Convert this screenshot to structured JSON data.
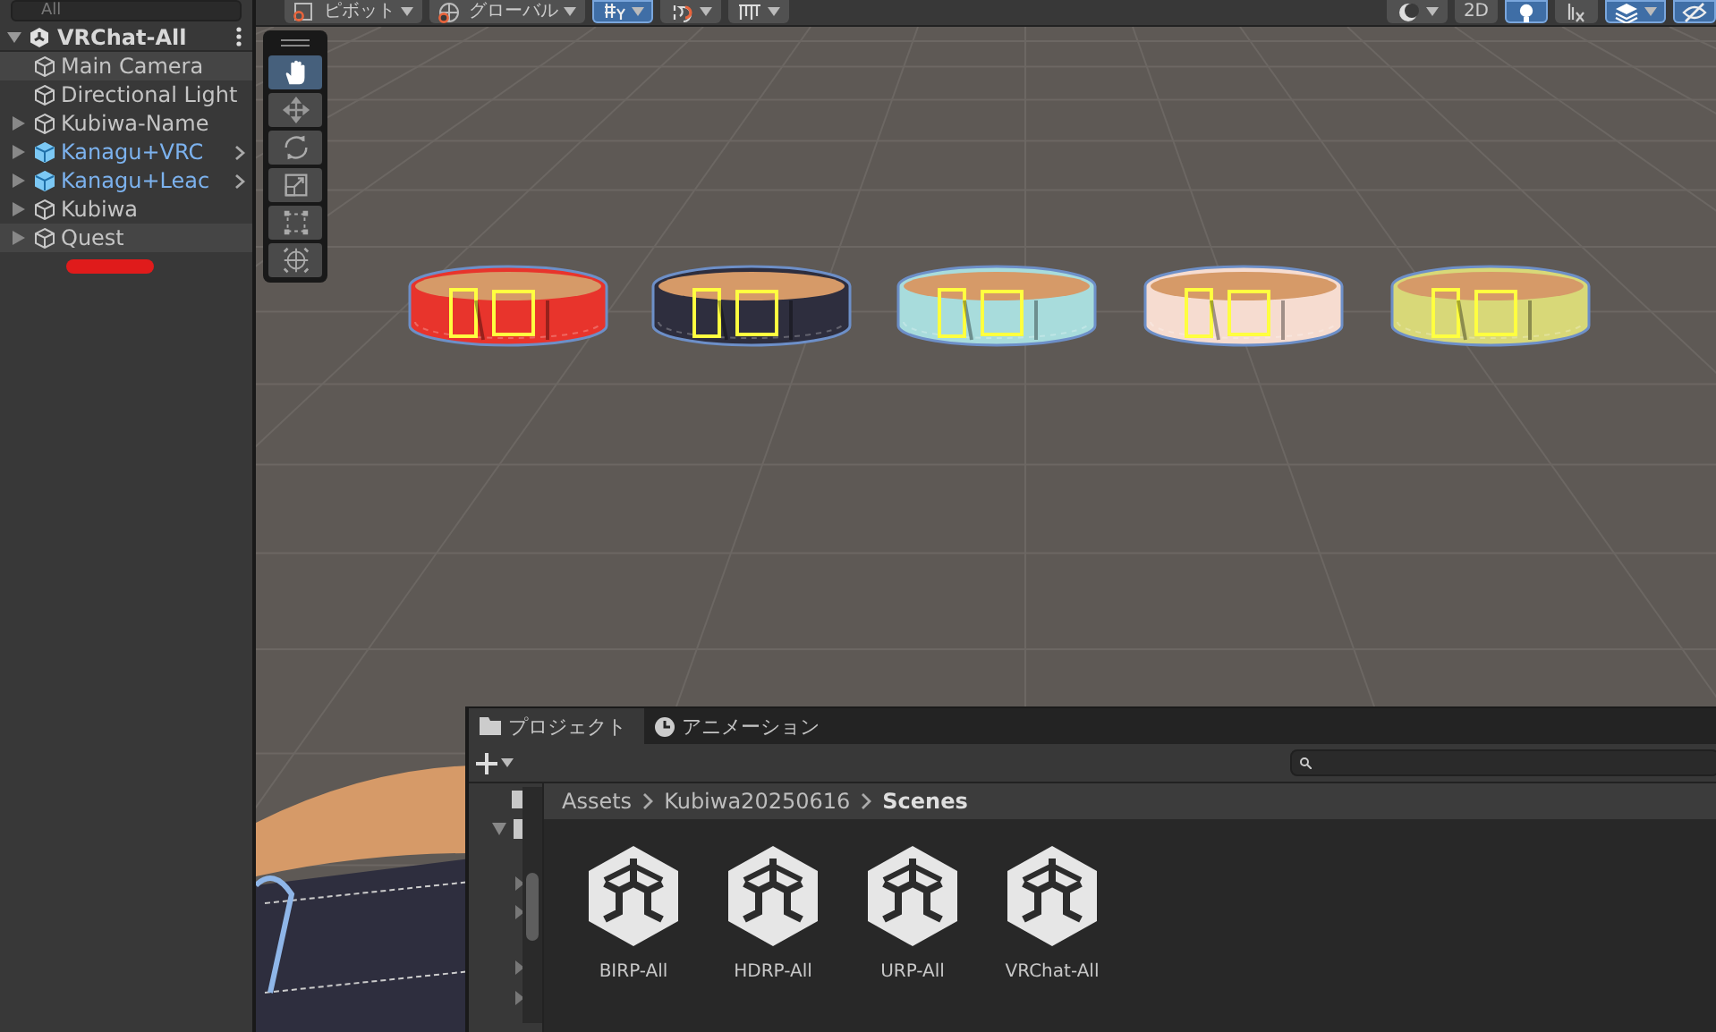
{
  "hierarchy": {
    "search": {
      "placeholder": "All"
    },
    "scene": {
      "name": "VRChat-All",
      "expanded": true
    },
    "items": [
      {
        "name": "Main Camera",
        "kind": "object",
        "expandable": false,
        "highlighted": true
      },
      {
        "name": "Directional Light",
        "kind": "object",
        "expandable": false,
        "highlighted": false
      },
      {
        "name": "Kubiwa-Name",
        "kind": "object",
        "expandable": true,
        "highlighted": false
      },
      {
        "name": "Kanagu+VRC",
        "kind": "prefab",
        "expandable": true,
        "highlighted": false
      },
      {
        "name": "Kanagu+Leac",
        "kind": "prefab",
        "expandable": true,
        "highlighted": false
      },
      {
        "name": "Kubiwa",
        "kind": "object",
        "expandable": true,
        "highlighted": false
      },
      {
        "name": "Quest",
        "kind": "object",
        "expandable": true,
        "highlighted": true
      }
    ]
  },
  "scene_toolbar": {
    "left": [
      {
        "kind": "pivot",
        "label": "ピボット"
      },
      {
        "kind": "global",
        "label": "グローバル"
      },
      {
        "kind": "grid",
        "active": true
      },
      {
        "kind": "snap",
        "active": false
      },
      {
        "kind": "ruler",
        "active": false
      }
    ],
    "right": [
      {
        "kind": "shading",
        "active": false
      },
      {
        "kind": "flat",
        "label": "2D",
        "active": false
      },
      {
        "kind": "light",
        "active": true
      },
      {
        "kind": "fx",
        "active": false
      },
      {
        "kind": "layers",
        "active": true
      },
      {
        "kind": "visibility",
        "active": true
      }
    ]
  },
  "tools": [
    {
      "kind": "hand",
      "selected": true
    },
    {
      "kind": "move",
      "selected": false
    },
    {
      "kind": "rotate",
      "selected": false
    },
    {
      "kind": "scale",
      "selected": false
    },
    {
      "kind": "rect",
      "selected": false
    },
    {
      "kind": "transform",
      "selected": false
    }
  ],
  "collars": [
    {
      "color": "#e8342c"
    },
    {
      "color": "#2e2e3e"
    },
    {
      "color": "#a8dcdc"
    },
    {
      "color": "#f6dcd0"
    },
    {
      "color": "#d8d878"
    }
  ],
  "project": {
    "tabs": [
      {
        "label": "プロジェクト",
        "kind": "folder",
        "selected": true
      },
      {
        "label": "アニメーション",
        "kind": "clock",
        "selected": false
      }
    ],
    "breadcrumb": [
      "Assets",
      "Kubiwa20250616",
      "Scenes"
    ],
    "assets": [
      {
        "name": "BIRP-All"
      },
      {
        "name": "HDRP-All"
      },
      {
        "name": "URP-All"
      },
      {
        "name": "VRChat-All"
      }
    ]
  }
}
